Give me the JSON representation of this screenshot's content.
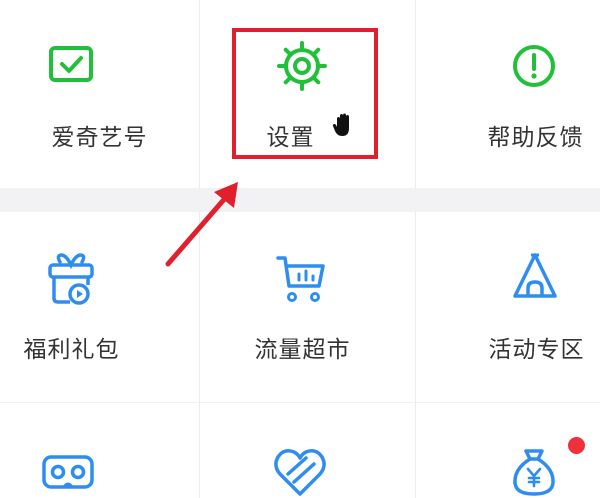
{
  "row1": {
    "items": [
      {
        "label": "爱奇艺号",
        "icon": "screen-check-icon"
      },
      {
        "label": "设置",
        "icon": "gear-icon"
      },
      {
        "label": "帮助反馈",
        "icon": "help-alert-icon"
      }
    ]
  },
  "row2": {
    "items": [
      {
        "label": "福利礼包",
        "icon": "gift-icon"
      },
      {
        "label": "流量超市",
        "icon": "shopping-cart-icon"
      },
      {
        "label": "活动专区",
        "icon": "tent-icon"
      }
    ]
  },
  "row3": {
    "items": [
      {
        "label": "",
        "icon": "vr-goggles-icon"
      },
      {
        "label": "",
        "icon": "heart-icon"
      },
      {
        "label": "",
        "icon": "money-bag-icon",
        "badge": true
      }
    ]
  },
  "colors": {
    "green": "#22c03a",
    "blue": "#2f8df0",
    "highlight": "#e0202c",
    "badge": "#f0303c"
  }
}
